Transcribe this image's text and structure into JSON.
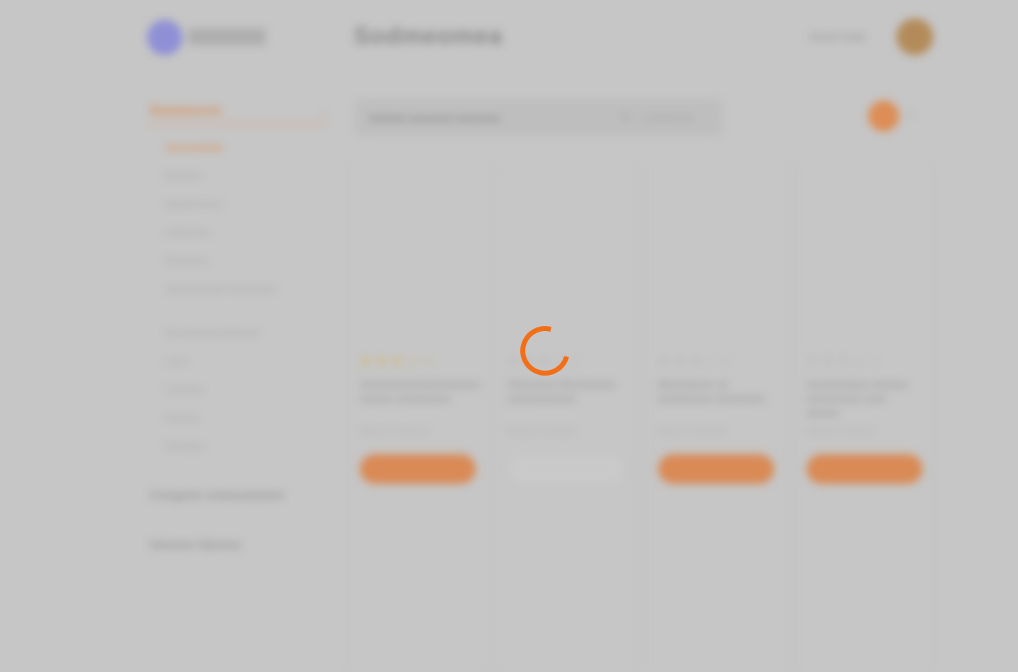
{
  "header": {
    "page_title": "Sodmeomea",
    "user_name": "Hunst Saar"
  },
  "sidebar": {
    "category_heading": "Doemescriv",
    "items": [
      {
        "label": "Amuuoteste"
      },
      {
        "label": "Bnnosm"
      },
      {
        "label": "Iaweenouner"
      },
      {
        "label": "Oatarmou"
      },
      {
        "label": "Itrrumens"
      },
      {
        "label": "Saorecamnoe Nmirnsons"
      },
      {
        "label": "Rounsionumuelnoree"
      },
      {
        "label": "Loon"
      },
      {
        "label": "Cohmee"
      },
      {
        "label": "Aonnos"
      },
      {
        "label": "Sseanos"
      }
    ],
    "section_a": "Coogrne oneeusiemnr",
    "section_b": "Unnnor ldonou"
  },
  "toolbar": {
    "search_placeholder": "Sommer sumnonm morrnmon",
    "sort_label": "Lomenmon",
    "cart_count": "0"
  },
  "cards": [
    {
      "title": "Aoennnonmmomeno nsoar onemnon",
      "meta": "Mononn moemom",
      "button": ""
    },
    {
      "title": "Oeeomn Nunnemo mnnoooeee",
      "meta": "Mononn moemom",
      "button": ""
    },
    {
      "title": "Nomoenn m Iommnoe nmeomn",
      "meta": "Mononn moemom",
      "button": ""
    },
    {
      "title": "Aonnnmeo annen nnmonoe noo anmo",
      "meta": "Mononn moemom",
      "button": ""
    }
  ],
  "status": {
    "loading": true
  }
}
